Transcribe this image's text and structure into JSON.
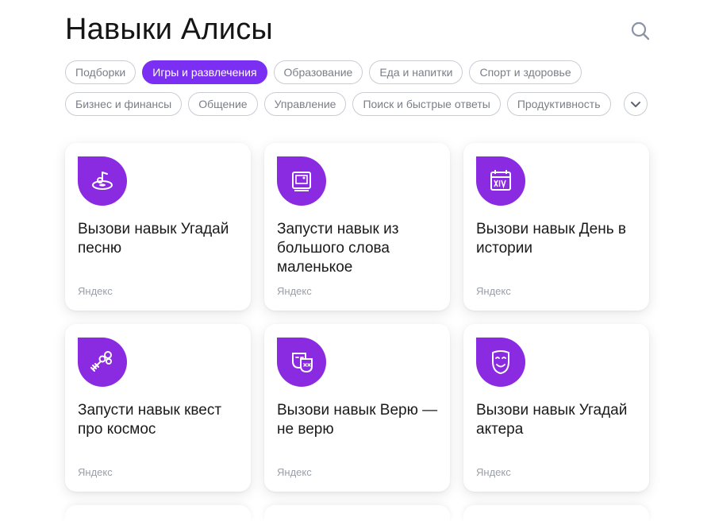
{
  "page": {
    "title": "Навыки Алисы"
  },
  "categories": {
    "row1": [
      "Подборки",
      "Игры и развлечения",
      "Образование",
      "Еда и напитки",
      "Спорт и здоровье"
    ],
    "row2": [
      "Бизнес и финансы",
      "Общение",
      "Управление",
      "Поиск и быстрые ответы",
      "Продуктивность"
    ],
    "active": "Игры и развлечения"
  },
  "skills": [
    {
      "name": "Вызови навык Угадай песню",
      "author": "Яндекс",
      "icon": "music-disc-icon"
    },
    {
      "name": "Запусти навык из большого слова маленькое",
      "author": "Яндекс",
      "icon": "word-card-icon"
    },
    {
      "name": "Вызови навык День в истории",
      "author": "Яндекс",
      "icon": "calendar-xiv-icon"
    },
    {
      "name": "Запусти навык квест про космос",
      "author": "Яндекс",
      "icon": "satellite-icon"
    },
    {
      "name": "Вызови навык Верю — не верю",
      "author": "Яндекс",
      "icon": "masks-icon"
    },
    {
      "name": "Вызови навык Угадай актера",
      "author": "Яндекс",
      "icon": "mask-icon"
    }
  ],
  "colors": {
    "accent": "#7b2ff2",
    "icon_bg": "#8a2be2"
  }
}
